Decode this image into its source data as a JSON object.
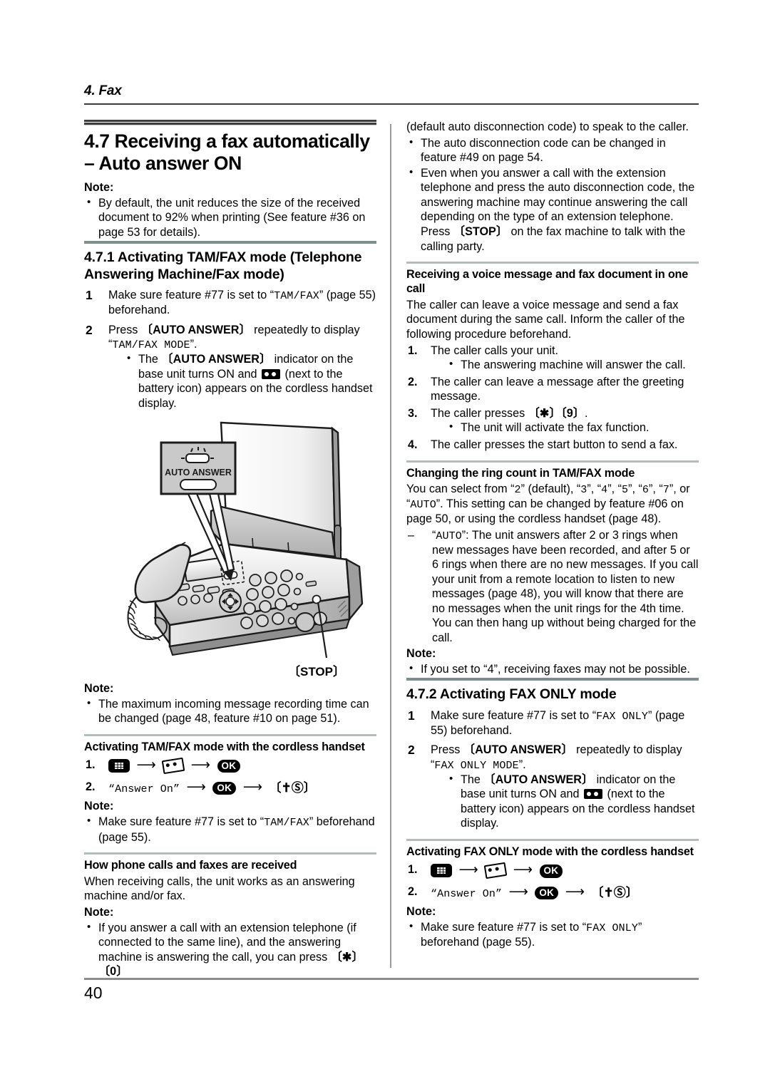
{
  "running_head": {
    "title": "4. Fax"
  },
  "page_number": "40",
  "left_column": {
    "section": {
      "title": "4.7 Receiving a fax automatically – Auto answer ON",
      "note_label": "Note:",
      "notes": [
        "By default, the unit reduces the size of the received document to 92% when printing (See feature #36 on page 53 for details)."
      ]
    },
    "subsection": {
      "title": "4.7.1 Activating TAM/FAX mode (Telephone Answering Machine/Fax mode)",
      "step1_pre": "Make sure feature #77 is set to “",
      "step1_mono": "TAM/FAX",
      "step1_post": "” (page 55) beforehand.",
      "step2_pre": "Press ",
      "step2_key": "{AUTO ANSWER}",
      "step2_mid": " repeatedly to display “",
      "step2_mono": "TAM/FAX MODE",
      "step2_post": "”.",
      "step2_bullet_a": "The ",
      "step2_bullet_key": "{AUTO ANSWER}",
      "step2_bullet_b": " indicator on the base unit turns ON and ",
      "step2_bullet_c": " (next to the battery icon) appears on the cordless handset display."
    },
    "figure": {
      "callout_label": "AUTO ANSWER",
      "stop_label": "{STOP}",
      "alt": "Fax machine with cordless handset, AUTO ANSWER button callout and STOP button pointer"
    },
    "note_after_figure": {
      "label": "Note:",
      "items": [
        "The maximum incoming message recording time can be changed (page 48, feature #10 on page 51)."
      ]
    },
    "cordless_block": {
      "title": "Activating TAM/FAX mode with the cordless handset",
      "step1": {
        "num": "1.",
        "icons": [
          "menu-icon",
          "cassette-icon",
          "ok-icon"
        ]
      },
      "step2": {
        "num": "2.",
        "quoted": "“Answer On”",
        "icons": [
          "ok-icon",
          "phone-off-hook-power-key"
        ]
      },
      "note_label": "Note:",
      "note_pre": "Make sure feature #77 is set to “",
      "note_mono": "TAM/FAX",
      "note_post": "” beforehand (page 55)."
    },
    "how_received": {
      "title": "How phone calls and faxes are received",
      "body": "When receiving calls, the unit works as an answering machine and/or fax.",
      "note_label": "Note:",
      "note_text_a": "If you answer a call with an extension telephone (if connected to the same line), and the answering machine is answering the call, you can press ",
      "note_key": "{ }{0}"
    }
  },
  "right_column": {
    "continuation": {
      "lead": "(default auto disconnection code) to speak to the caller.",
      "bullets": [
        "The auto disconnection code can be changed in feature #49 on page 54.",
        "Even when you answer a call with the extension telephone and press the auto disconnection code, the answering machine may continue answering the call depending on the type of an extension telephone. Press {STOP} on the fax machine to talk with the calling party."
      ],
      "bullet2_part1": "Even when you answer a call with the extension telephone and press the auto disconnection code, the answering machine may continue answering the call depending on the type of an extension telephone. Press ",
      "bullet2_key": "{STOP}",
      "bullet2_part2": " on the fax machine to talk with the calling party."
    },
    "voice_and_fax": {
      "title": "Receiving a voice message and fax document in one call",
      "body": "The caller can leave a voice message and send a fax document during the same call. Inform the caller of the following procedure beforehand.",
      "step1": "The caller calls your unit.",
      "step1_sub": "The answering machine will answer the call.",
      "step2": "The caller can leave a message after the greeting message.",
      "step3_pre": "The caller presses ",
      "step3_key": "{ }{9}",
      "step3_post": ".",
      "step3_sub": "The unit will activate the fax function.",
      "step4": "The caller presses the start button to send a fax."
    },
    "ring_count": {
      "title": "Changing the ring count in TAM/FAX mode",
      "body_pre": "You can select from “",
      "opt1": "2",
      "body_mid1": "” (default), “",
      "opt2": "3",
      "body_mid2": "”, “",
      "opt3": "4",
      "body_mid3": "”, “",
      "opt4": "5",
      "body_mid4": "”, “",
      "opt5": "6",
      "body_mid5": "”, “",
      "opt6": "7",
      "body_mid6": "”, or “",
      "opt7": "AUTO",
      "body_post": "”. This setting can be changed by feature #06 on page 50, or using the cordless handset (page 48).",
      "dash_pre": "“",
      "dash_mono": "AUTO",
      "dash_post": "”: The unit answers after 2 or 3 rings when new messages have been recorded, and after 5 or 6 rings when there are no new messages. If you call your unit from a remote location to listen to new messages (page 48), you will know that there are no messages when the unit rings for the 4th time. You can then hang up without being charged for the call.",
      "note_label": "Note:",
      "note": "If you set to “4”, receiving faxes may not be possible."
    },
    "fax_only": {
      "title": "4.7.2 Activating FAX ONLY mode",
      "step1_pre": "Make sure feature #77 is set to “",
      "step1_mono": "FAX ONLY",
      "step1_post": "” (page 55) beforehand.",
      "step2_pre": "Press ",
      "step2_key": "{AUTO ANSWER}",
      "step2_mid": " repeatedly to display “",
      "step2_mono": "FAX ONLY MODE",
      "step2_post": "”.",
      "step2_bullet_a": "The ",
      "step2_bullet_key": "{AUTO ANSWER}",
      "step2_bullet_b": " indicator on the base unit turns ON and ",
      "step2_bullet_c": " (next to the battery icon) appears on the cordless handset display."
    },
    "fax_only_cordless": {
      "title": "Activating FAX ONLY mode with the cordless handset",
      "step1": {
        "num": "1.",
        "icons": [
          "menu-icon",
          "cassette-icon",
          "ok-icon"
        ]
      },
      "step2": {
        "num": "2.",
        "quoted": "“Answer On”",
        "icons": [
          "ok-icon",
          "phone-off-hook-power-key"
        ]
      },
      "note_label": "Note:",
      "note_pre": "Make sure feature #77 is set to “",
      "note_mono": "FAX ONLY",
      "note_post": "” beforehand (page 55)."
    }
  },
  "colors": {
    "rule_major": "#3f3f3f",
    "rule_section": "#7d8e8e",
    "rule_thin": "#b4bcb8",
    "column_divider": "#9a9a9a",
    "footer_rule": "#8c8c8c"
  }
}
